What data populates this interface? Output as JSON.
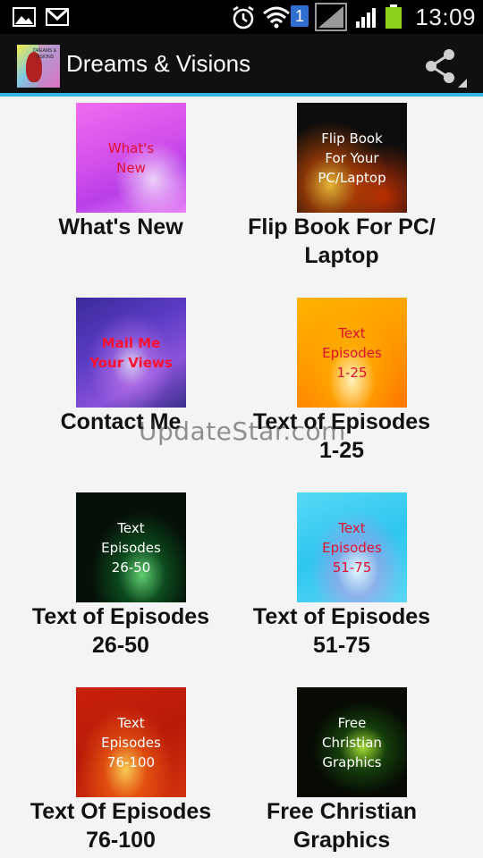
{
  "status_bar": {
    "time": "13:09",
    "sim_badge": "1",
    "icons": [
      "gallery-icon",
      "gmail-icon",
      "alarm-icon",
      "wifi-icon",
      "sim-icon",
      "signal-icon",
      "battery-icon"
    ]
  },
  "action_bar": {
    "title": "Dreams & Visions",
    "logo_text": "DREAMS & VISIONS",
    "share_icon": "share-icon"
  },
  "items": [
    {
      "label": "What's New",
      "thumb_text": "What's\nNew"
    },
    {
      "label": "Flip Book For PC/\nLaptop",
      "thumb_text": "Flip Book\nFor Your\nPC/Laptop"
    },
    {
      "label": "Contact Me",
      "thumb_text": "Mail Me\nYour Views"
    },
    {
      "label": "Text of Episodes\n1-25",
      "thumb_text": "Text\nEpisodes\n1-25"
    },
    {
      "label": "Text of Episodes\n26-50",
      "thumb_text": "Text\nEpisodes\n26-50"
    },
    {
      "label": "Text of Episodes\n51-75",
      "thumb_text": "Text\nEpisodes\n51-75"
    },
    {
      "label": "Text Of Episodes\n76-100",
      "thumb_text": "Text\nEpisodes\n76-100"
    },
    {
      "label": "Free Christian\nGraphics",
      "thumb_text": "Free\nChristian\nGraphics"
    }
  ],
  "watermark": "UpdateStar.com",
  "colors": {
    "status_bar_bg": "#000000",
    "action_bar_bg": "#101010",
    "action_bar_accent": "#33b5e5",
    "content_bg": "#f4f4f4",
    "label_text": "#111111"
  }
}
